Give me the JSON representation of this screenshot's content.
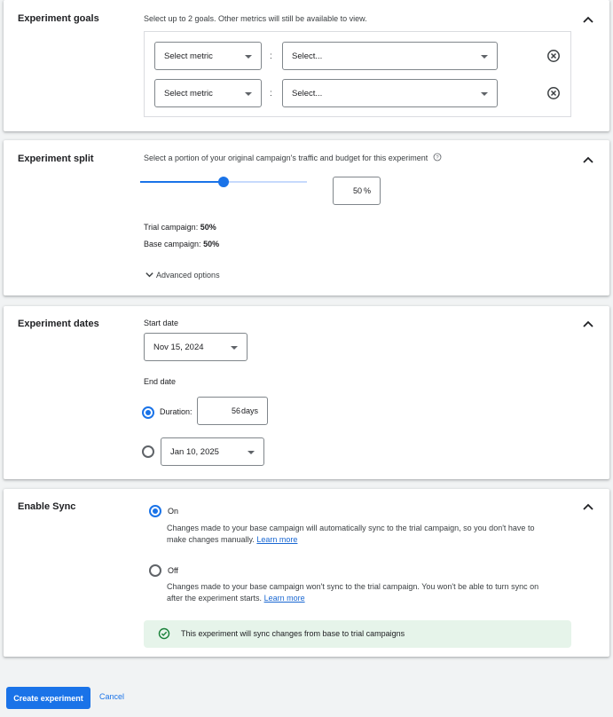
{
  "goals": {
    "title": "Experiment goals",
    "description": "Select up to 2 goals. Other metrics will still be available to view.",
    "rows": [
      {
        "metric": "Select metric",
        "separator": ":",
        "value": "Select..."
      },
      {
        "metric": "Select metric",
        "separator": ":",
        "value": "Select..."
      }
    ]
  },
  "split": {
    "title": "Experiment split",
    "description": "Select a portion of your original campaign's traffic and budget for this experiment",
    "slider_percent": 50,
    "input_value": "50",
    "input_unit": "%",
    "trial_label": "Trial campaign:",
    "trial_value": "50%",
    "base_label": "Base campaign:",
    "base_value": "50%",
    "advanced_label": "Advanced options"
  },
  "dates": {
    "title": "Experiment dates",
    "start_label": "Start date",
    "start_value": "Nov 15, 2024",
    "end_label": "End date",
    "duration_label": "Duration:",
    "duration_value": "56",
    "duration_unit": "days",
    "end_date_value": "Jan 10, 2025"
  },
  "sync": {
    "title": "Enable Sync",
    "on_label": "On",
    "on_desc_1": "Changes made to your base campaign will automatically sync to the trial campaign, so you don't have to",
    "on_desc_2": "make changes manually.",
    "off_label": "Off",
    "off_desc_1": "Changes made to your base campaign won't sync to the trial campaign. You won't be able to turn sync on",
    "off_desc_2": "after the experiment starts.",
    "learn_more": "Learn more",
    "banner_text": "This experiment will sync changes from base to trial campaigns"
  },
  "footer": {
    "create_label": "Create experiment",
    "cancel_label": "Cancel"
  },
  "colors": {
    "primary": "#1a73e8",
    "success": "#188038",
    "banner_bg": "#e6f4ea"
  }
}
